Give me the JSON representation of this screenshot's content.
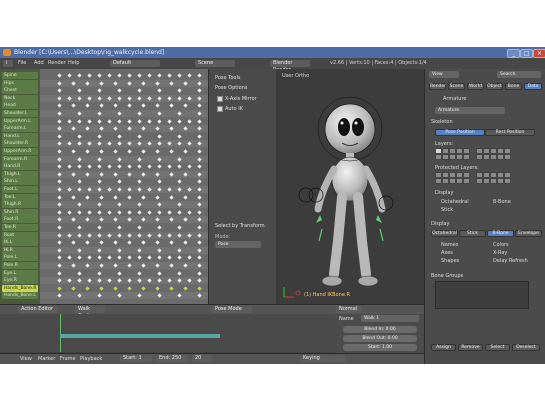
{
  "window": {
    "title": "Blender [C:\\Users\\...\\Desktop\\rig_walkcycle.blend]",
    "min": "_",
    "max": "□",
    "close": "×"
  },
  "menubar": {
    "items": [
      "File",
      "Add",
      "Render",
      "Help"
    ],
    "layout": "Default",
    "scene": "Scene",
    "engine": "Blender Render",
    "stats": "v2.66 | Verts:10 | Faces:4 | Objects:1/4"
  },
  "dopesheet": {
    "channels": [
      "Spine",
      "Hips",
      "Chest",
      "Neck",
      "Head",
      "Shoulder.L",
      "UpperArm.L",
      "Forearm.L",
      "Hand.L",
      "Shoulder.R",
      "UpperArm.R",
      "Forearm.R",
      "Hand.R",
      "Thigh.L",
      "Shin.L",
      "Foot.L",
      "Toe.L",
      "Thigh.R",
      "Shin.R",
      "Foot.R",
      "Toe.R",
      "Root",
      "IK.L",
      "IK.R",
      "Pole.L",
      "Pole.R",
      "Eye.L",
      "Eye.R",
      "Hands_Bone.R",
      "Hands_Bone.L"
    ],
    "selected_index": 28,
    "mode": "Action Editor",
    "action_name": "Walk Cycle"
  },
  "tool_panel": {
    "pose_tools": "Pose Tools",
    "pose_options": "Pose Options",
    "auto_ik": "Auto IK",
    "x_axis_mirror": "X-Axis Mirror",
    "select_by_transform": "Select by Transform",
    "mode_label": "Mode:",
    "mode_value": "Pose"
  },
  "viewport": {
    "label": "User Ortho",
    "object_label": "(1) Hand IKBone.R",
    "mode": "Pose Mode",
    "pivot": "Normal"
  },
  "properties": {
    "view_label": "View",
    "search": "Search",
    "tabs": [
      "Render",
      "Scene",
      "World",
      "Object",
      "Bone",
      "Data"
    ],
    "breadcrumb_obj": "Armature",
    "breadcrumb_field": "Armature",
    "subtab_pose": "Pose Position",
    "subtab_rest": "Rest Position",
    "section_skeleton": "Skeleton",
    "layers_label": "Layers:",
    "protected_label": "Protected Layers:",
    "display_section": "Display",
    "display_btns": [
      "Octahedral",
      "Stick",
      "B-Bone",
      "Envelope"
    ],
    "names": "Names",
    "axes": "Axes",
    "shapes": "Shapes",
    "colors": "Colors",
    "xray": "X-Ray",
    "delay_refresh": "Delay Refresh",
    "bone_groups": "Bone Groups",
    "assign": "Assign",
    "remove": "Remove",
    "select": "Select",
    "deselect": "Deselect"
  },
  "nla": {
    "strip_label": "Name",
    "strip_value": "Walk 1",
    "fields": [
      "Blend In: 0.00",
      "Blend Out: 0.00",
      "Start: 1.00",
      "Length: 20"
    ]
  },
  "timeline": {
    "menu": [
      "View",
      "Marker",
      "Frame",
      "Playback"
    ],
    "frame_start": "Start: 1",
    "frame_end": "End: 250",
    "current": "20",
    "autokey": "Keying"
  },
  "colors": {
    "channel_sel": "#c8d84a",
    "key": "#f0f0f0",
    "accent": "#5680c2"
  }
}
